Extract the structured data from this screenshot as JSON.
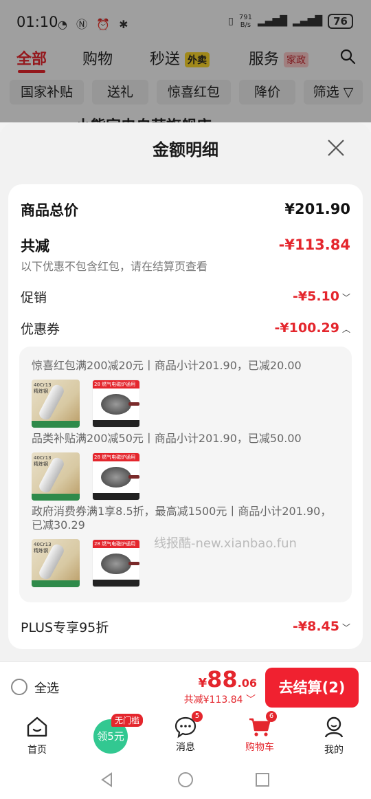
{
  "status_bar": {
    "time": "01:10",
    "speed_value": "791",
    "speed_unit": "B/s",
    "battery": "76"
  },
  "top_tabs": [
    {
      "label": "全部",
      "active": true
    },
    {
      "label": "购物"
    },
    {
      "label": "秒送",
      "badge": "外卖"
    },
    {
      "label": "服务",
      "badge": "家政"
    }
  ],
  "filters": [
    "国家补贴",
    "送礼",
    "惊喜红包",
    "降价",
    "筛选"
  ],
  "behind_store_text": "小熊家电自营旗舰店",
  "sheet": {
    "title": "金额明细",
    "total_label": "商品总价",
    "total_value": "¥201.90",
    "reduce_label": "共减",
    "reduce_value": "-¥113.84",
    "reduce_note": "以下优惠不包含红包，请在结算页查看",
    "promo_label": "促销",
    "promo_value": "-¥5.10",
    "coupon_label": "优惠券",
    "coupon_value": "-¥100.29",
    "coupons": [
      {
        "text": "惊喜红包满200减20元丨商品小计201.90，已减20.00"
      },
      {
        "text": "品类补贴满200减50元丨商品小计201.90，已减50.00"
      },
      {
        "text": "政府消费券满1享8.5折，最高减1500元丨商品小计201.90，已减30.29"
      }
    ],
    "plus_label": "PLUS专享95折",
    "plus_value": "-¥8.45",
    "watermark": "线报酷-new.xianbao.fun"
  },
  "checkout": {
    "select_all": "全选",
    "price_currency": "¥",
    "price_int": "88",
    "price_dec": ".06",
    "saved": "共减¥113.84",
    "pay_button": "去结算(2)"
  },
  "bottom_nav": [
    {
      "label": "首页",
      "icon": "home-icon"
    },
    {
      "label": "领5元",
      "icon": "coupon-icon",
      "tag": "无门槛"
    },
    {
      "label": "消息",
      "icon": "message-icon",
      "badge": "5"
    },
    {
      "label": "购物车",
      "icon": "cart-icon",
      "badge": "6",
      "active": true
    },
    {
      "label": "我的",
      "icon": "profile-icon"
    }
  ],
  "colors": {
    "accent": "#e4262d",
    "pay_button": "#f02130",
    "coupon_green": "#32c891"
  }
}
